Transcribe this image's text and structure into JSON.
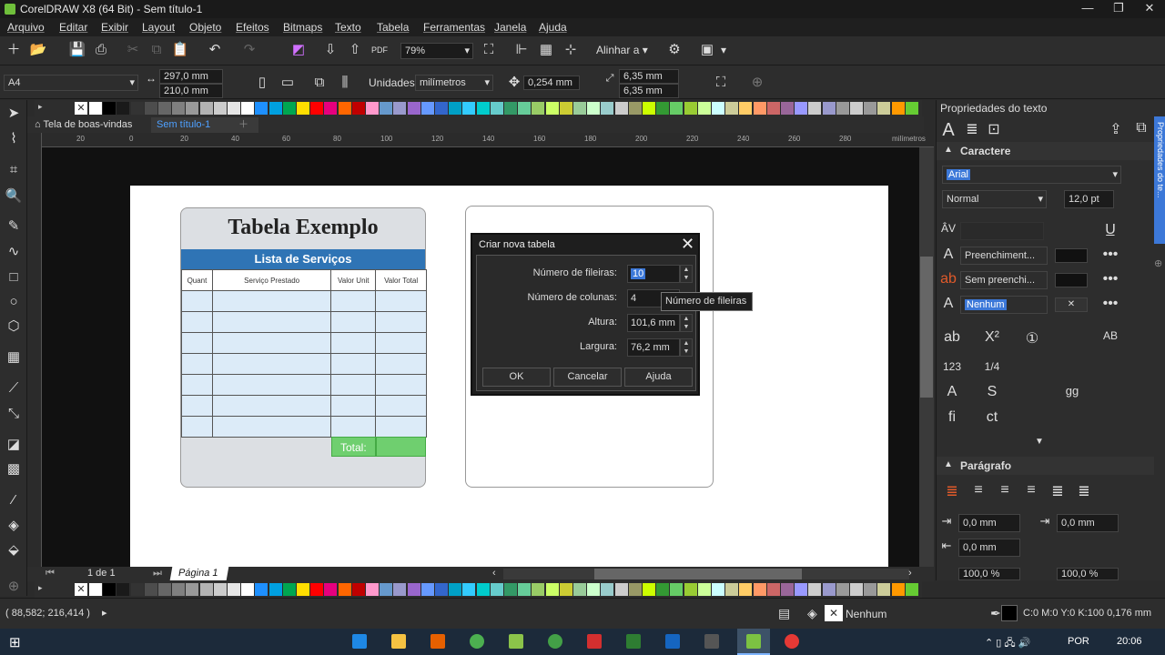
{
  "window": {
    "title": "CorelDRAW X8 (64 Bit) - Sem título-1"
  },
  "menu": [
    "Arquivo",
    "Editar",
    "Exibir",
    "Layout",
    "Objeto",
    "Efeitos",
    "Bitmaps",
    "Texto",
    "Tabela",
    "Ferramentas",
    "Janela",
    "Ajuda"
  ],
  "toolbar": {
    "zoom": "79%",
    "align_label": "Alinhar a"
  },
  "propbar": {
    "page_size": "A4",
    "width": "297,0 mm",
    "height": "210,0 mm",
    "units_label": "Unidades:",
    "units_value": "milímetros",
    "nudge": "0,254 mm",
    "dup_x": "6,35 mm",
    "dup_y": "6,35 mm"
  },
  "tabs": {
    "welcome": "Tela de boas-vindas",
    "doc": "Sem título-1"
  },
  "ruler": {
    "labels": [
      "20",
      "0",
      "20",
      "40",
      "60",
      "80",
      "100",
      "120",
      "140",
      "160",
      "180",
      "200",
      "220",
      "240",
      "260",
      "280"
    ],
    "unit": "milímetros"
  },
  "design": {
    "title": "Tabela Exemplo",
    "band": "Lista de Serviços",
    "headers": [
      "Quant",
      "Serviço Prestado",
      "Valor Unit",
      "Valor Total"
    ],
    "total": "Total:"
  },
  "dialog": {
    "title": "Criar nova tabela",
    "rows_label": "Número de fileiras:",
    "rows_value": "10",
    "cols_label": "Número de colunas:",
    "cols_value": "4",
    "height_label": "Altura:",
    "height_value": "101,6 mm",
    "width_label": "Largura:",
    "width_value": "76,2 mm",
    "ok": "OK",
    "cancel": "Cancelar",
    "help": "Ajuda"
  },
  "tooltip": "Número de fileiras",
  "pagenav": {
    "count": "1 de 1",
    "page": "Página 1"
  },
  "status": {
    "coords": "( 88,582; 216,414 )",
    "fill": "Nenhum",
    "outline": "C:0 M:0 Y:0 K:100  0,176 mm"
  },
  "docker": {
    "title": "Propriedades do texto",
    "side_tab": "Propriedades do te...",
    "section_char": "Caractere",
    "font": "Arial",
    "style": "Normal",
    "size": "12,0 pt",
    "fill1": "Preenchiment...",
    "fill2": "Sem preenchi...",
    "outline": "Nenhum",
    "section_para": "Parágrafo",
    "indent1": "0,0 mm",
    "indent2": "0,0 mm",
    "indent3": "0,0 mm",
    "spacing1": "100,0 %",
    "spacing2": "100,0 %"
  },
  "taskbar": {
    "lang": "POR",
    "time": "20:06"
  },
  "palette": [
    "#ffffff",
    "#000000",
    "#1a1a1a",
    "#333333",
    "#4d4d4d",
    "#666666",
    "#808080",
    "#999999",
    "#b3b3b3",
    "#cccccc",
    "#e6e6e6",
    "#ffffff",
    "#1e90ff",
    "#00a0e0",
    "#00a651",
    "#ffde00",
    "#ff0000",
    "#e6007e",
    "#ff6600",
    "#c00000",
    "#ff99cc",
    "#6699cc",
    "#9999cc",
    "#9966cc",
    "#6699ff",
    "#3366cc",
    "#00a0c6",
    "#33ccff",
    "#00cccc",
    "#66cccc",
    "#339966",
    "#66cc99",
    "#99cc66",
    "#ccff66",
    "#cccc33",
    "#99cc99",
    "#ccffcc",
    "#99cccc",
    "#cccccc",
    "#999966",
    "#ccff00",
    "#339933",
    "#66cc66",
    "#99cc33",
    "#ccff99",
    "#ccffff",
    "#cccc99",
    "#ffcc66",
    "#ff9966",
    "#cc6666",
    "#996699",
    "#9999ff",
    "#cccccc",
    "#9999cc",
    "#999999",
    "#cccccc",
    "#999999",
    "#cccc99",
    "#ff9900",
    "#66cc33"
  ]
}
